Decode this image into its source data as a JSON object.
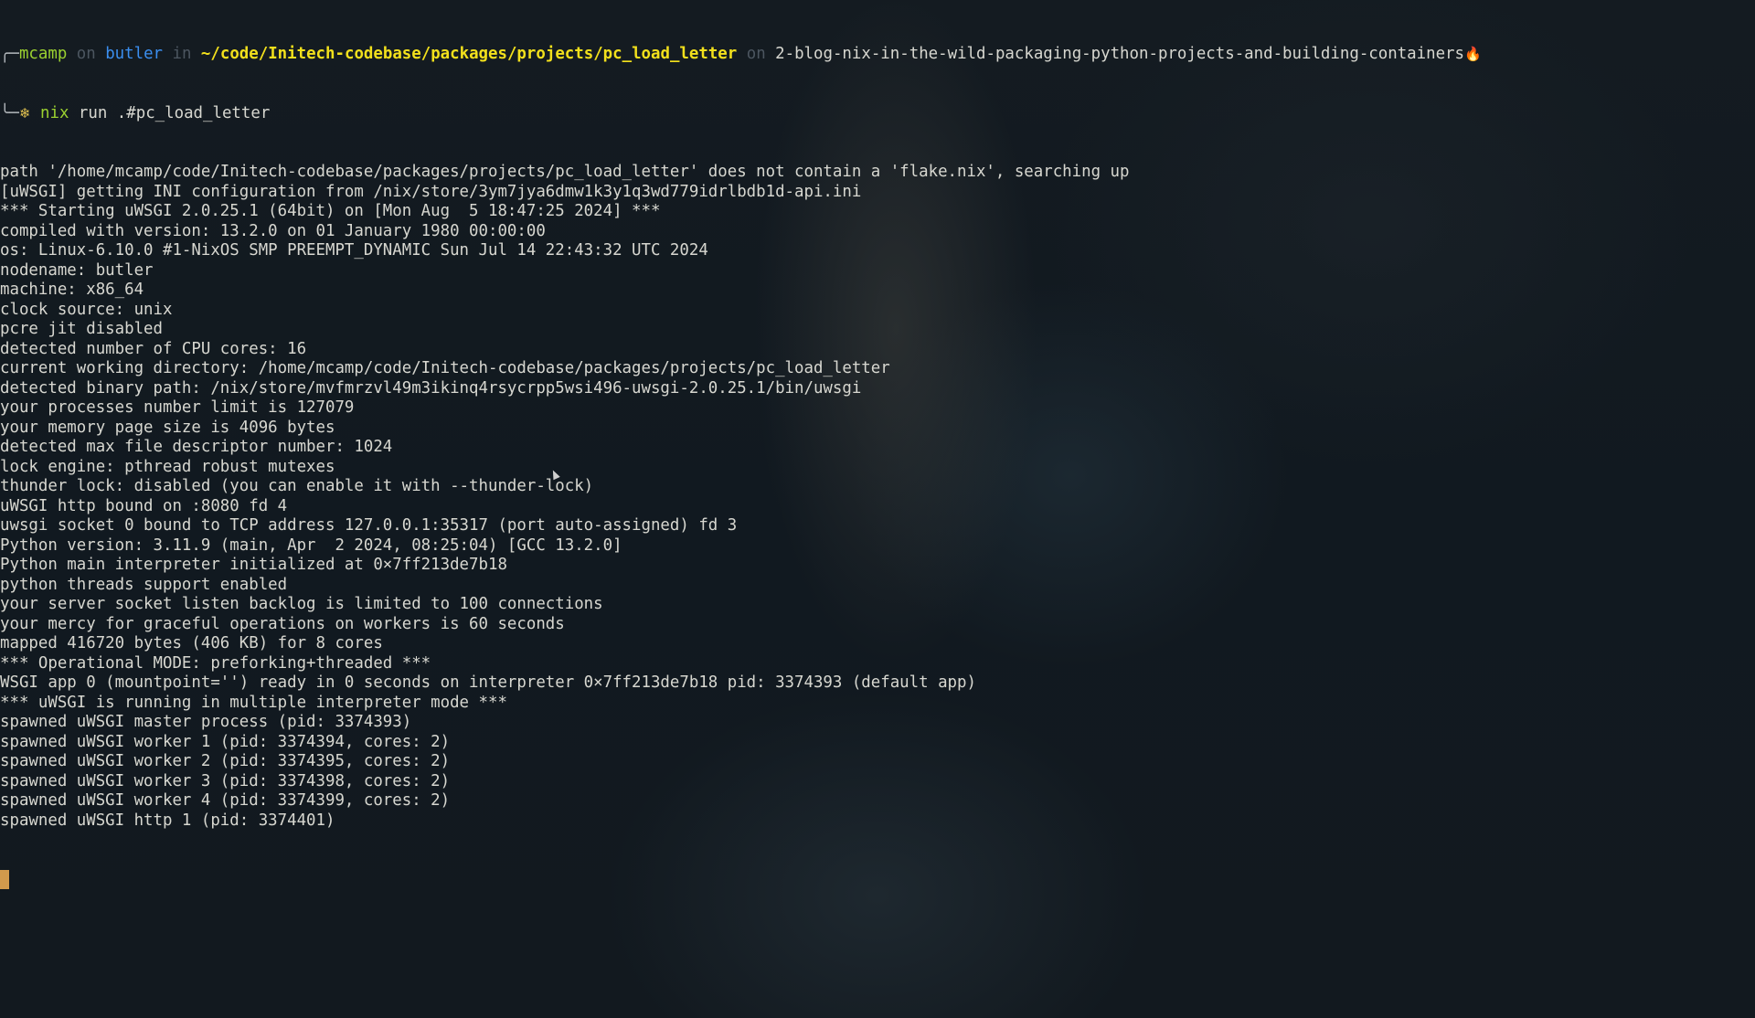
{
  "prompt": {
    "corner": "╭─",
    "user": "mcamp",
    "on1": " on ",
    "host": "butler",
    "in": " in ",
    "path": "~/code/Initech-codebase/packages/projects/pc_load_letter",
    "on2": " on ",
    "branch": "2-blog-nix-in-the-wild-packaging-python-projects-and-building-containers",
    "branch_icon": "🔥",
    "corner2": "╰─",
    "nix_icon": "❄",
    "command": "nix",
    "args": " run .#pc_load_letter"
  },
  "output_lines": [
    "path '/home/mcamp/code/Initech-codebase/packages/projects/pc_load_letter' does not contain a 'flake.nix', searching up",
    "[uWSGI] getting INI configuration from /nix/store/3ym7jya6dmw1k3y1q3wd779idrlbdb1d-api.ini",
    "*** Starting uWSGI 2.0.25.1 (64bit) on [Mon Aug  5 18:47:25 2024] ***",
    "compiled with version: 13.2.0 on 01 January 1980 00:00:00",
    "os: Linux-6.10.0 #1-NixOS SMP PREEMPT_DYNAMIC Sun Jul 14 22:43:32 UTC 2024",
    "nodename: butler",
    "machine: x86_64",
    "clock source: unix",
    "pcre jit disabled",
    "detected number of CPU cores: 16",
    "current working directory: /home/mcamp/code/Initech-codebase/packages/projects/pc_load_letter",
    "detected binary path: /nix/store/mvfmrzvl49m3ikinq4rsycrpp5wsi496-uwsgi-2.0.25.1/bin/uwsgi",
    "your processes number limit is 127079",
    "your memory page size is 4096 bytes",
    "detected max file descriptor number: 1024",
    "lock engine: pthread robust mutexes",
    "thunder lock: disabled (you can enable it with --thunder-lock)",
    "uWSGI http bound on :8080 fd 4",
    "uwsgi socket 0 bound to TCP address 127.0.0.1:35317 (port auto-assigned) fd 3",
    "Python version: 3.11.9 (main, Apr  2 2024, 08:25:04) [GCC 13.2.0]",
    "Python main interpreter initialized at 0×7ff213de7b18",
    "python threads support enabled",
    "your server socket listen backlog is limited to 100 connections",
    "your mercy for graceful operations on workers is 60 seconds",
    "mapped 416720 bytes (406 KB) for 8 cores",
    "*** Operational MODE: preforking+threaded ***",
    "WSGI app 0 (mountpoint='') ready in 0 seconds on interpreter 0×7ff213de7b18 pid: 3374393 (default app)",
    "*** uWSGI is running in multiple interpreter mode ***",
    "spawned uWSGI master process (pid: 3374393)",
    "spawned uWSGI worker 1 (pid: 3374394, cores: 2)",
    "spawned uWSGI worker 2 (pid: 3374395, cores: 2)",
    "spawned uWSGI worker 3 (pid: 3374398, cores: 2)",
    "spawned uWSGI worker 4 (pid: 3374399, cores: 2)",
    "spawned uWSGI http 1 (pid: 3374401)"
  ],
  "colors": {
    "background": "#0f161c",
    "text": "#d7d7d0",
    "user": "#9bd130",
    "host": "#3b8ff0",
    "path": "#f2e01c",
    "cursor": "#d19a4c"
  }
}
